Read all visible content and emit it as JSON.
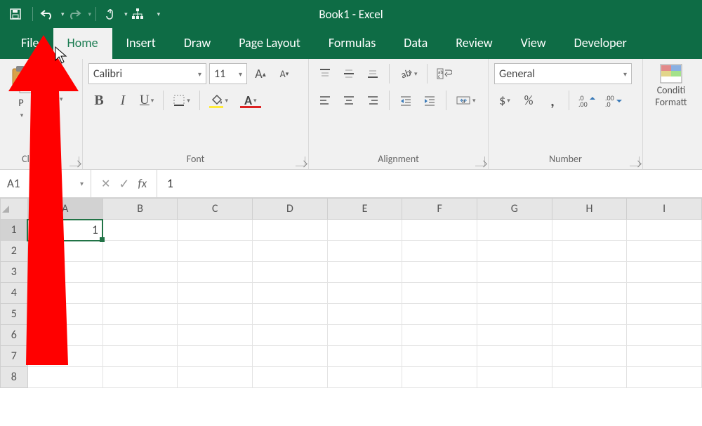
{
  "app": {
    "title": "Book1  -  Excel"
  },
  "tabs": {
    "items": [
      {
        "label": "File",
        "active": false
      },
      {
        "label": "Home",
        "active": true
      },
      {
        "label": "Insert",
        "active": false
      },
      {
        "label": "Draw",
        "active": false
      },
      {
        "label": "Page Layout",
        "active": false
      },
      {
        "label": "Formulas",
        "active": false
      },
      {
        "label": "Data",
        "active": false
      },
      {
        "label": "Review",
        "active": false
      },
      {
        "label": "View",
        "active": false
      },
      {
        "label": "Developer",
        "active": false
      }
    ]
  },
  "ribbon": {
    "clipboard": {
      "label": "Clipboard"
    },
    "font": {
      "label": "Font",
      "name": "Calibri",
      "size": "11"
    },
    "alignment": {
      "label": "Alignment"
    },
    "number": {
      "label": "Number",
      "format": "General"
    },
    "styles": {
      "conditional1": "Conditi",
      "conditional2": "Formatt"
    }
  },
  "formula_bar": {
    "cell_ref": "A1",
    "fx": "fx",
    "value": "1"
  },
  "grid": {
    "columns": [
      "A",
      "B",
      "C",
      "D",
      "E",
      "F",
      "G",
      "H",
      "I"
    ],
    "rows": [
      "1",
      "2",
      "3",
      "4",
      "5",
      "6",
      "7",
      "8"
    ],
    "selected_col": 0,
    "selected_row": 0,
    "cell_A1": "1"
  }
}
